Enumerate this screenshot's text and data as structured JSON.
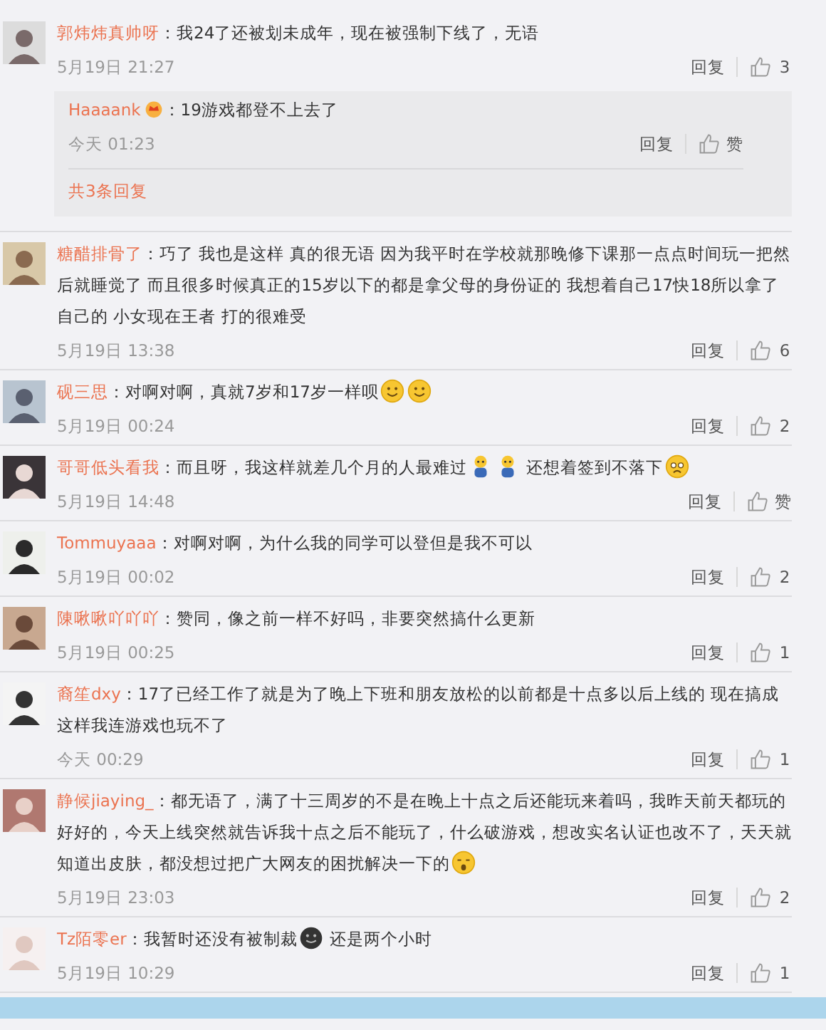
{
  "comments": [
    {
      "name": "郭炜炜真帅呀",
      "segments": [
        {
          "kind": "text",
          "text": "：我24了还被划未成年，现在被强制下线了，无语"
        }
      ],
      "time": "5月19日 21:27",
      "reply_label": "回复",
      "likes": "3",
      "replies": [
        {
          "name": "Haaaank",
          "name_badge": true,
          "segments": [
            {
              "kind": "text",
              "text": "：19游戏都登不上去了"
            }
          ],
          "time": "今天 01:23",
          "reply_label": "回复",
          "likes": "赞"
        }
      ],
      "more_replies": "共3条回复"
    },
    {
      "name": "糖醋排骨了",
      "segments": [
        {
          "kind": "text",
          "text": "：巧了 我也是这样 真的很无语 因为我平时在学校就那晚修下课那一点点时间玩一把然后就睡觉了 而且很多时候真正的15岁以下的都是拿父母的身份证的 我想着自己17快18所以拿了自己的 小女现在王者 打的很难受"
        }
      ],
      "time": "5月19日 13:38",
      "reply_label": "回复",
      "likes": "6"
    },
    {
      "name": "砚三思",
      "segments": [
        {
          "kind": "text",
          "text": "：对啊对啊，真就7岁和17岁一样呗"
        },
        {
          "kind": "smile"
        },
        {
          "kind": "smile"
        }
      ],
      "time": "5月19日 00:24",
      "reply_label": "回复",
      "likes": "2"
    },
    {
      "name": "哥哥低头看我",
      "segments": [
        {
          "kind": "text",
          "text": "：而且呀，我这样就差几个月的人最难过"
        },
        {
          "kind": "crying"
        },
        {
          "kind": "crying"
        },
        {
          "kind": "text",
          "text": " 还想着签到不落下"
        },
        {
          "kind": "sad"
        }
      ],
      "time": "5月19日 14:48",
      "reply_label": "回复",
      "likes": "赞"
    },
    {
      "name": "Tommuyaaa",
      "segments": [
        {
          "kind": "text",
          "text": "：对啊对啊，为什么我的同学可以登但是我不可以"
        }
      ],
      "time": "5月19日 00:02",
      "reply_label": "回复",
      "likes": "2"
    },
    {
      "name": "陳啾啾吖吖吖",
      "segments": [
        {
          "kind": "text",
          "text": "：赞同，像之前一样不好吗，非要突然搞什么更新"
        }
      ],
      "time": "5月19日 00:25",
      "reply_label": "回复",
      "likes": "1"
    },
    {
      "name": "裔笙dxy",
      "segments": [
        {
          "kind": "text",
          "text": "：17了已经工作了就是为了晚上下班和朋友放松的以前都是十点多以后上线的 现在搞成这样我连游戏也玩不了"
        }
      ],
      "time": "今天 00:29",
      "reply_label": "回复",
      "likes": "1"
    },
    {
      "name": "静候jiaying_",
      "segments": [
        {
          "kind": "text",
          "text": "：都无语了，满了十三周岁的不是在晚上十点之后还能玩来着吗，我昨天前天都玩的好好的，今天上线突然就告诉我十点之后不能玩了，什么破游戏，想改实名认证也改不了，天天就知道出皮肤，都没想过把广大网友的困扰解决一下的"
        },
        {
          "kind": "smirk"
        }
      ],
      "time": "5月19日 23:03",
      "reply_label": "回复",
      "likes": "2"
    },
    {
      "name": "Tz陌零er",
      "segments": [
        {
          "kind": "text",
          "text": "：我暂时还没有被制裁"
        },
        {
          "kind": "dark"
        },
        {
          "kind": "text",
          "text": " 还是两个小时"
        }
      ],
      "time": "5月19日 10:29",
      "reply_label": "回复",
      "likes": "1"
    }
  ]
}
